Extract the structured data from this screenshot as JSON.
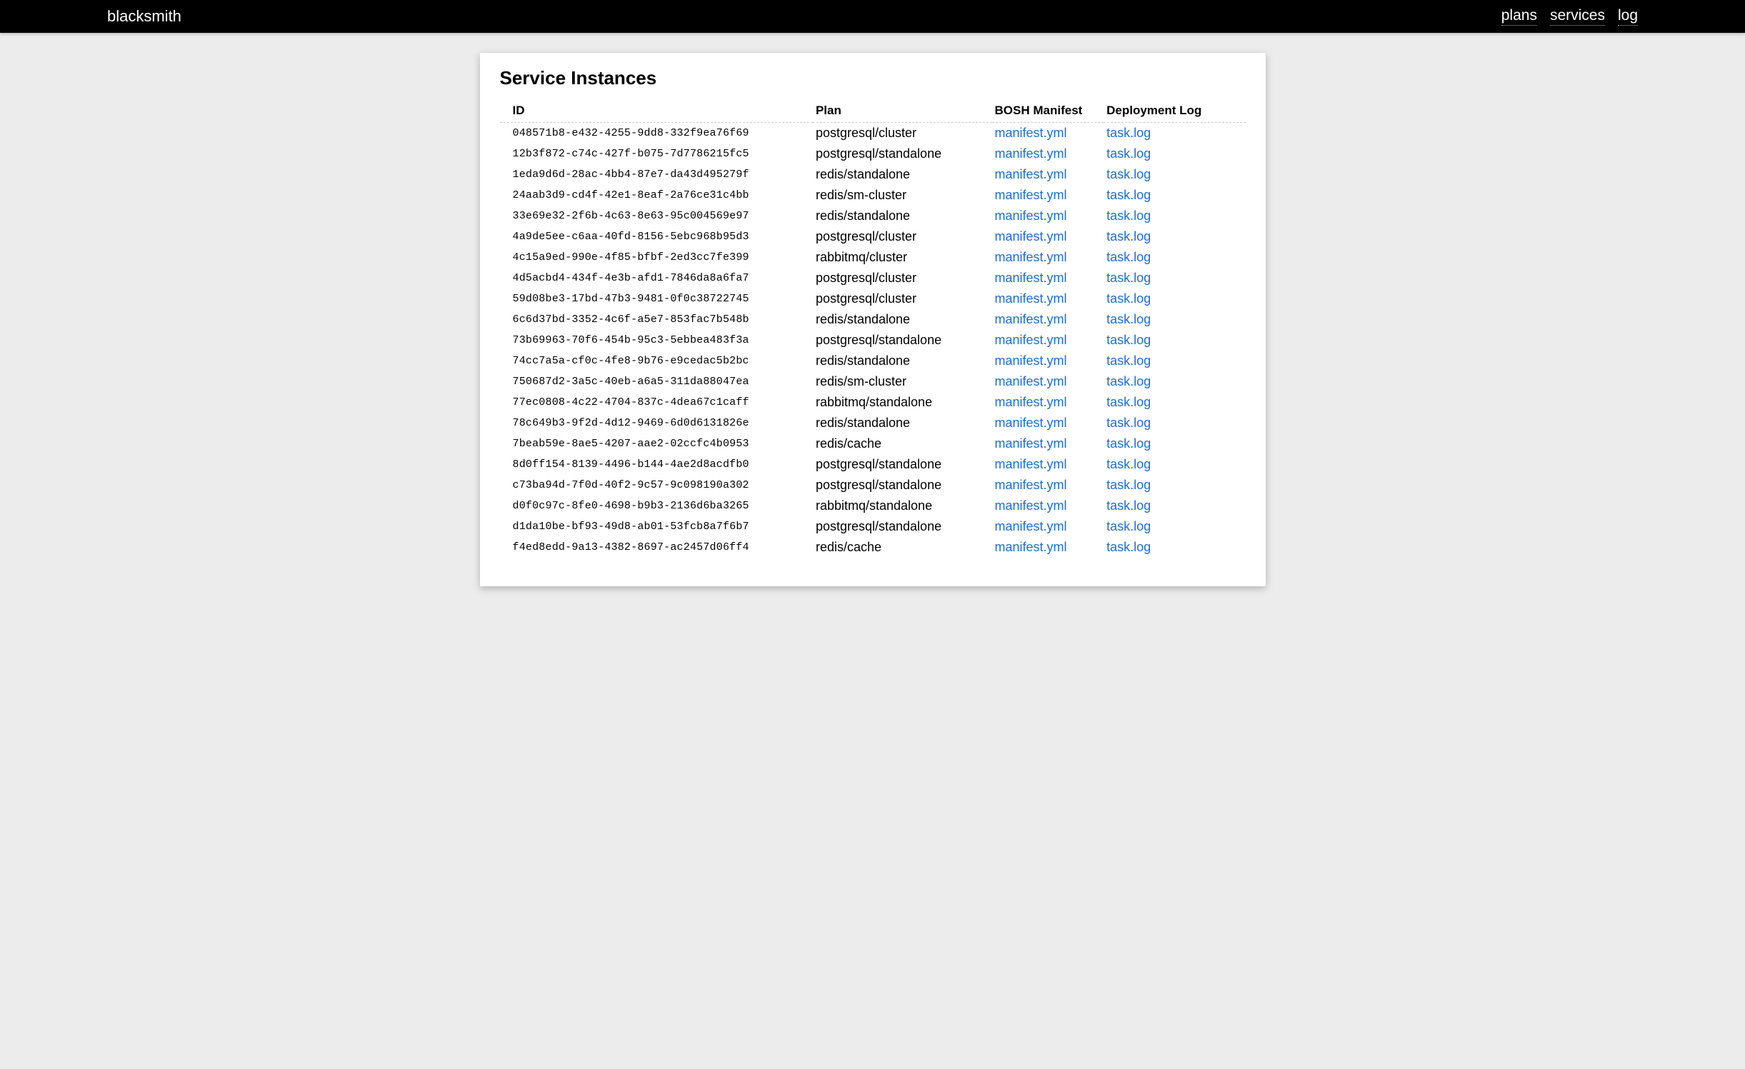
{
  "brand": "blacksmith",
  "nav": {
    "plans": "plans",
    "services": "services",
    "log": "log"
  },
  "page": {
    "title": "Service Instances"
  },
  "table": {
    "headers": {
      "id": "ID",
      "plan": "Plan",
      "manifest": "BOSH Manifest",
      "log": "Deployment Log"
    },
    "manifest_link_label": "manifest.yml",
    "log_link_label": "task.log",
    "rows": [
      {
        "id": "048571b8-e432-4255-9dd8-332f9ea76f69",
        "plan": "postgresql/cluster"
      },
      {
        "id": "12b3f872-c74c-427f-b075-7d7786215fc5",
        "plan": "postgresql/standalone"
      },
      {
        "id": "1eda9d6d-28ac-4bb4-87e7-da43d495279f",
        "plan": "redis/standalone"
      },
      {
        "id": "24aab3d9-cd4f-42e1-8eaf-2a76ce31c4bb",
        "plan": "redis/sm-cluster"
      },
      {
        "id": "33e69e32-2f6b-4c63-8e63-95c004569e97",
        "plan": "redis/standalone"
      },
      {
        "id": "4a9de5ee-c6aa-40fd-8156-5ebc968b95d3",
        "plan": "postgresql/cluster"
      },
      {
        "id": "4c15a9ed-990e-4f85-bfbf-2ed3cc7fe399",
        "plan": "rabbitmq/cluster"
      },
      {
        "id": "4d5acbd4-434f-4e3b-afd1-7846da8a6fa7",
        "plan": "postgresql/cluster"
      },
      {
        "id": "59d08be3-17bd-47b3-9481-0f0c38722745",
        "plan": "postgresql/cluster"
      },
      {
        "id": "6c6d37bd-3352-4c6f-a5e7-853fac7b548b",
        "plan": "redis/standalone"
      },
      {
        "id": "73b69963-70f6-454b-95c3-5ebbea483f3a",
        "plan": "postgresql/standalone"
      },
      {
        "id": "74cc7a5a-cf0c-4fe8-9b76-e9cedac5b2bc",
        "plan": "redis/standalone"
      },
      {
        "id": "750687d2-3a5c-40eb-a6a5-311da88047ea",
        "plan": "redis/sm-cluster"
      },
      {
        "id": "77ec0808-4c22-4704-837c-4dea67c1caff",
        "plan": "rabbitmq/standalone"
      },
      {
        "id": "78c649b3-9f2d-4d12-9469-6d0d6131826e",
        "plan": "redis/standalone"
      },
      {
        "id": "7beab59e-8ae5-4207-aae2-02ccfc4b0953",
        "plan": "redis/cache"
      },
      {
        "id": "8d0ff154-8139-4496-b144-4ae2d8acdfb0",
        "plan": "postgresql/standalone"
      },
      {
        "id": "c73ba94d-7f0d-40f2-9c57-9c098190a302",
        "plan": "postgresql/standalone"
      },
      {
        "id": "d0f0c97c-8fe0-4698-b9b3-2136d6ba3265",
        "plan": "rabbitmq/standalone"
      },
      {
        "id": "d1da10be-bf93-49d8-ab01-53fcb8a7f6b7",
        "plan": "postgresql/standalone"
      },
      {
        "id": "f4ed8edd-9a13-4382-8697-ac2457d06ff4",
        "plan": "redis/cache"
      }
    ]
  }
}
